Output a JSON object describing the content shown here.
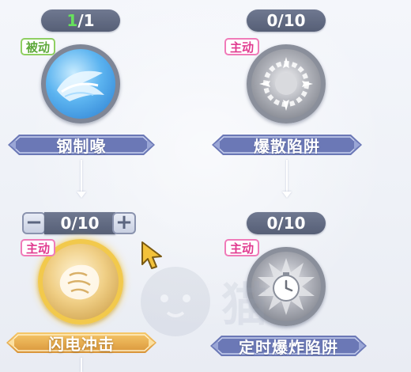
{
  "skills": [
    {
      "name": "钢制喙",
      "type_tag": "被动",
      "level_current": "1",
      "level_max": "1"
    },
    {
      "name": "爆散陷阱",
      "type_tag": "主动",
      "level_text": "0/10"
    },
    {
      "name": "闪电冲击",
      "type_tag": "主动",
      "level_text": "0/10"
    },
    {
      "name": "定时爆炸陷阱",
      "type_tag": "主动",
      "level_text": "0/10"
    }
  ],
  "stepper": {
    "minus": "−",
    "plus": "+"
  },
  "level_separator": "/",
  "watermark_text": "猫",
  "colors": {
    "counter_bg": "#5f687f",
    "passive_tag": "#5da83a",
    "active_tag": "#e0398f",
    "banner_blue": "#6b78b6",
    "banner_gold": "#e6a84a",
    "selected_ring": "#f2c94c"
  }
}
